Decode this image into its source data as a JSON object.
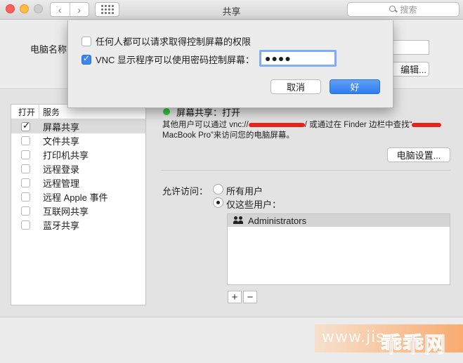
{
  "window": {
    "title": "共享"
  },
  "toolbar": {
    "back_glyph": "‹",
    "forward_glyph": "›",
    "search_placeholder": "搜索"
  },
  "top": {
    "computer_name_label": "电脑名称",
    "edit_button": "编辑..."
  },
  "service_list": {
    "col_on": "打开",
    "col_service": "服务",
    "items": [
      {
        "label": "屏幕共享",
        "checked": true
      },
      {
        "label": "文件共享",
        "checked": false
      },
      {
        "label": "打印机共享",
        "checked": false
      },
      {
        "label": "远程登录",
        "checked": false
      },
      {
        "label": "远程管理",
        "checked": false
      },
      {
        "label": "远程 Apple 事件",
        "checked": false
      },
      {
        "label": "互联网共享",
        "checked": false
      },
      {
        "label": "蓝牙共享",
        "checked": false
      }
    ]
  },
  "detail": {
    "status": "屏幕共享：打开",
    "status_color": "#31c43c",
    "desc_part1": "其他用户可以通过 vnc://",
    "desc_part2": "/ 或通过在 Finder 边栏中查找“",
    "desc_part3": "MacBook Pro”来访问您的电脑屏幕。",
    "settings_button": "电脑设置...",
    "access_label": "允许访问：",
    "radio_all": "所有用户",
    "radio_only": "仅这些用户：",
    "users": [
      "Administrators"
    ],
    "add_button": "+",
    "remove_button": "−"
  },
  "sheet": {
    "option_anyone": "任何人都可以请求取得控制屏幕的权限",
    "option_vnc": "VNC 显示程序可以使用密码控制屏幕：",
    "password_value": "●●●●",
    "cancel_button": "取消",
    "ok_button": "好"
  },
  "watermark": {
    "site_text": "www.jis",
    "logo_text": "乖乖网"
  },
  "colors": {
    "accent": "#3b86f0",
    "redaction": "#e7251c"
  }
}
